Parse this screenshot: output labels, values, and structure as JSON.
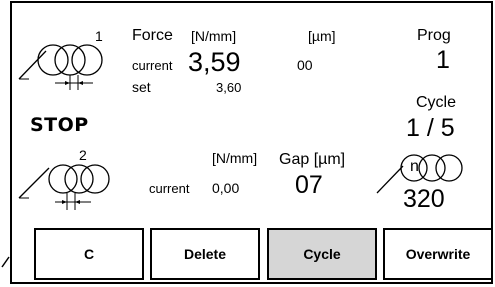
{
  "top_unit": {
    "index": "1",
    "force_label": "Force",
    "force_unit": "[N/mm]",
    "gap_unit": "[µm]",
    "current_label": "current",
    "current_value": "3,59",
    "set_label": "set",
    "set_value": "3,60",
    "gap_value": "00"
  },
  "status": {
    "stop_label": "STOP"
  },
  "bottom_unit": {
    "index": "2",
    "force_unit": "[N/mm]",
    "current_label": "current",
    "current_value": "0,00",
    "gap_label": "Gap [µm]",
    "gap_value": "07"
  },
  "program": {
    "prog_label": "Prog",
    "prog_value": "1",
    "cycle_label": "Cycle",
    "cycle_value": "1 / 5",
    "n_label": "n",
    "n_value": "320"
  },
  "buttons": {
    "c_label": "C",
    "delete_label": "Delete",
    "cycle_label": "Cycle",
    "overwrite_label": "Overwrite"
  }
}
